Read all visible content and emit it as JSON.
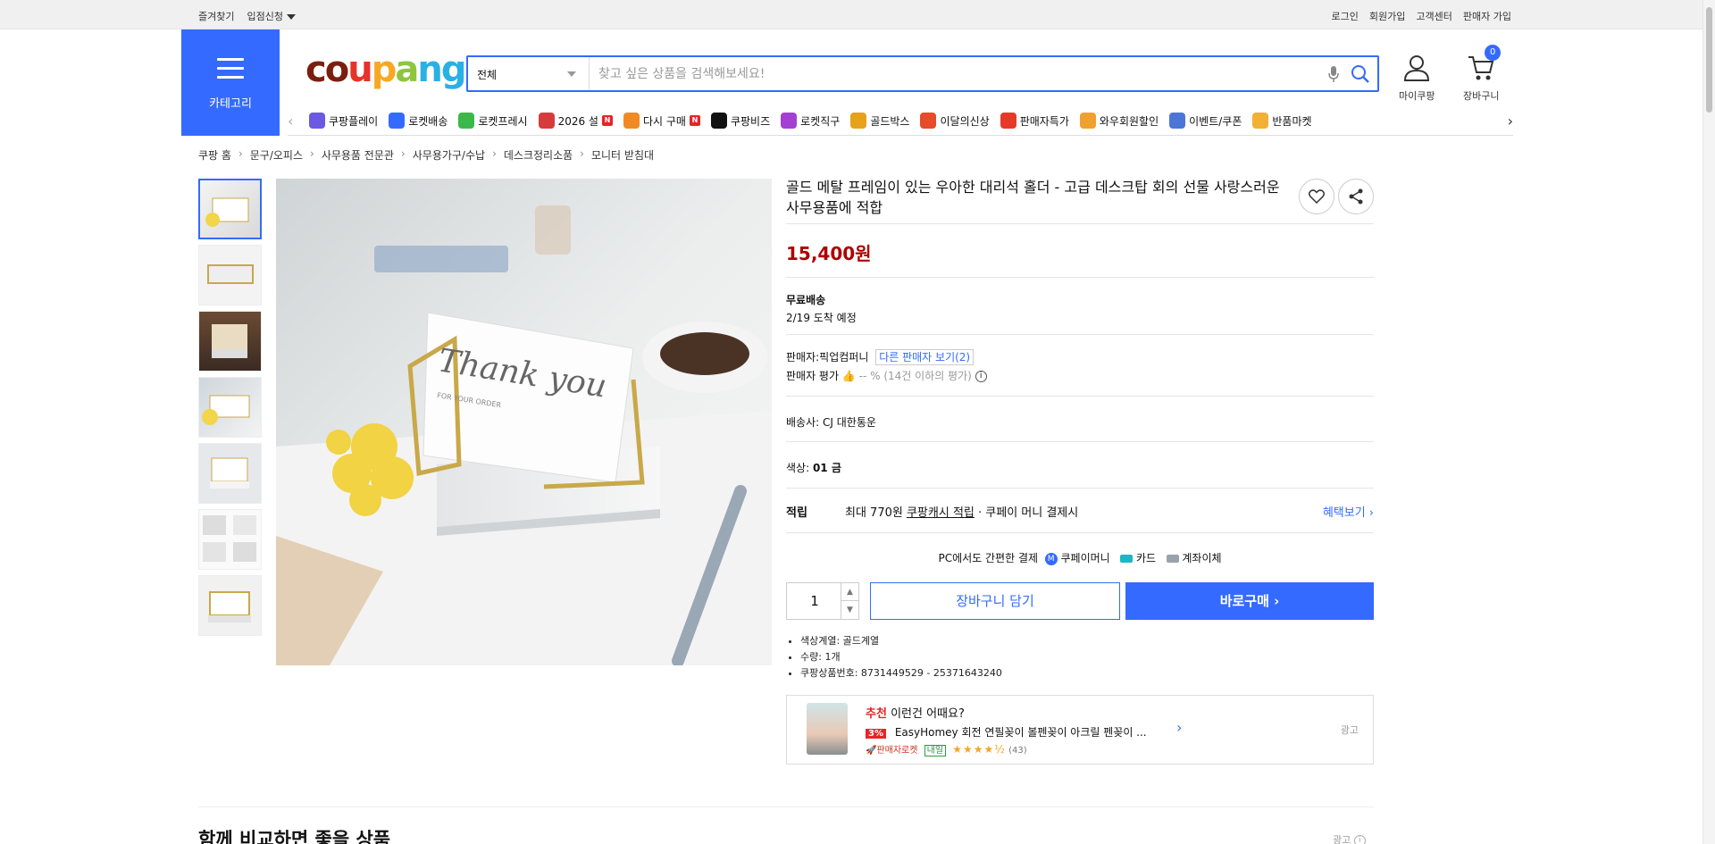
{
  "topbar": {
    "left": [
      "즐겨찾기",
      "입점신청"
    ],
    "right": [
      "로그인",
      "회원가입",
      "고객센터",
      "판매자 가입"
    ]
  },
  "header": {
    "category_label": "카테고리",
    "logo_text": "coupang",
    "search_select": "전체",
    "search_placeholder": "찾고 싶은 상품을 검색해보세요!",
    "my_coupang": "마이쿠팡",
    "cart": "장바구니",
    "cart_count": "0"
  },
  "nav": [
    {
      "label": "쿠팡플레이",
      "icon": "play-icon",
      "color": "#6b59e3",
      "badge": ""
    },
    {
      "label": "로켓배송",
      "icon": "rocket-icon",
      "color": "#346aff",
      "badge": ""
    },
    {
      "label": "로켓프레시",
      "icon": "rocket-fresh-icon",
      "color": "#3cb84a",
      "badge": ""
    },
    {
      "label": "2026 설",
      "icon": "gift-icon",
      "color": "#d73c3c",
      "badge": "N"
    },
    {
      "label": "다시 구매",
      "icon": "home-icon",
      "color": "#f08a24",
      "badge": "N"
    },
    {
      "label": "쿠팡비즈",
      "icon": "biz-icon",
      "color": "#111111",
      "badge": ""
    },
    {
      "label": "로켓직구",
      "icon": "global-rocket-icon",
      "color": "#a33fd3",
      "badge": ""
    },
    {
      "label": "골드박스",
      "icon": "goldbox-icon",
      "color": "#e7a21a",
      "badge": ""
    },
    {
      "label": "이달의신상",
      "icon": "new-icon",
      "color": "#e64b2a",
      "badge": ""
    },
    {
      "label": "판매자특가",
      "icon": "percent-icon",
      "color": "#e53a28",
      "badge": ""
    },
    {
      "label": "와우회원할인",
      "icon": "wow-icon",
      "color": "#f0a030",
      "badge": ""
    },
    {
      "label": "이벤트/쿠폰",
      "icon": "coupon-icon",
      "color": "#4b76d8",
      "badge": ""
    },
    {
      "label": "반품마켓",
      "icon": "return-market-icon",
      "color": "#f2b134",
      "badge": ""
    }
  ],
  "breadcrumb": [
    "쿠팡 홈",
    "문구/오피스",
    "사무용품 전문관",
    "사무용가구/수납",
    "데스크정리소품",
    "모니터 받침대"
  ],
  "product": {
    "title": "골드 메탈 프레임이 있는 우아한 대리석 홀더 - 고급 데스크탑 회의 선물 사랑스러운 사무용품에 적합",
    "price": "15,400원",
    "shipping_title": "무료배송",
    "arrival": "2/19 도착 예정",
    "seller_label": "판매자:",
    "seller_name": "픽업컴퍼니",
    "other_seller": "다른 판매자 보기(2)",
    "rating_label": "판매자 평가",
    "rating_value": "-- % (14건 이하의 평가)",
    "courier_label": "배송사:",
    "courier": "CJ 대한통운",
    "color_label": "색상:",
    "color_value": "01 금",
    "points_label": "적립",
    "points_prefix": "최대 770원",
    "points_cash": "쿠팡캐시 적립",
    "points_suffix": "· 쿠페이 머니 결제시",
    "benefit": "혜택보기",
    "pay_title": "PC에서도 간편한 결제",
    "pay_1": "쿠페이머니",
    "pay_2": "카드",
    "pay_3": "계좌이체",
    "qty": "1",
    "add_cart": "장바구니 담기",
    "buy_now": "바로구매",
    "bullets": [
      "색상계열: 골드계열",
      "수량: 1개",
      "쿠팡상품번호: 8731449529 - 25371643240"
    ]
  },
  "reco": {
    "head_red": "추천",
    "head": "이런건 어때요?",
    "discount": "3%",
    "name": "EasyHomey 회전 연필꽂이 볼펜꽂이 아크릴 펜꽂이 ...",
    "rocket": "판매자로켓",
    "tag": "내일",
    "stars": "★★★★½",
    "count": "(43)",
    "ad": "광고"
  },
  "bottom": {
    "title": "함께 비교하면 좋을 상품",
    "ad": "광고"
  }
}
